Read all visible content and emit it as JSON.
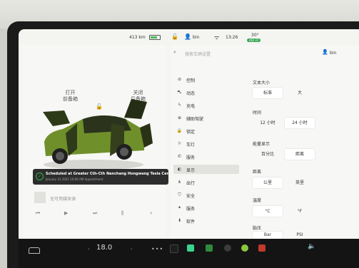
{
  "status": {
    "range": "413 km",
    "user": "bin",
    "time": "13:26",
    "outside_temp": "30°",
    "air_quality": "AQI 37"
  },
  "car_panel": {
    "front_trunk": {
      "action": "打开",
      "label": "前备箱"
    },
    "rear_trunk": {
      "action": "关闭",
      "label": "后备箱"
    },
    "notification": {
      "title": "Scheduled at Greater Cth-Cth Nanchang Hongwang Tesla Center",
      "subtitle": "January 31 2021 10:00 AM Appointment"
    },
    "media": {
      "source_label": "无可用媒体源",
      "controls": [
        "⏮",
        "▶",
        "⏭",
        "⫼",
        "⌕"
      ]
    }
  },
  "settings": {
    "search_placeholder": "搜索车辆设置",
    "user": "bin",
    "menu": [
      {
        "icon": "toggle-icon",
        "label": "控制",
        "active": false
      },
      {
        "icon": "car-icon",
        "label": "动态",
        "active": false
      },
      {
        "icon": "bolt-icon",
        "label": "充电",
        "active": false
      },
      {
        "icon": "steering-icon",
        "label": "辅助驾驶",
        "active": false
      },
      {
        "icon": "lock-icon",
        "label": "锁定",
        "active": false
      },
      {
        "icon": "light-icon",
        "label": "车灯",
        "active": false
      },
      {
        "icon": "phone-icon",
        "label": "服务",
        "active": false
      },
      {
        "icon": "display-icon",
        "label": "显示",
        "active": true
      },
      {
        "icon": "route-icon",
        "label": "出行",
        "active": false
      },
      {
        "icon": "shield-icon",
        "label": "安全",
        "active": false
      },
      {
        "icon": "wrench-icon",
        "label": "服务",
        "active": false
      },
      {
        "icon": "download-icon",
        "label": "软件",
        "active": false
      }
    ],
    "groups": [
      {
        "label": "文本大小",
        "options": [
          "标准",
          "大"
        ],
        "selected": 0
      },
      {
        "label": "时间",
        "options": [
          "12 小时",
          "24 小时"
        ],
        "selected": 1
      },
      {
        "label": "能量显示",
        "options": [
          "百分比",
          "距离"
        ],
        "selected": 1
      },
      {
        "label": "距离",
        "options": [
          "公里",
          "英里"
        ],
        "selected": 0
      },
      {
        "label": "温度",
        "options": [
          "°C",
          "°F"
        ],
        "selected": 0
      },
      {
        "label": "胎压",
        "options": [
          "Bar",
          "PSI"
        ],
        "selected": 0
      }
    ]
  },
  "dock": {
    "cabin_temp": "18.0",
    "apps": [
      {
        "icon": "camera-app-icon",
        "color": "#1e1e1e"
      },
      {
        "icon": "phone-app-icon",
        "color": "#3ad58e"
      },
      {
        "icon": "calendar-app-icon",
        "color": "#2f8a3c"
      },
      {
        "icon": "toybox-app-icon",
        "color": "#3b3b3b"
      },
      {
        "icon": "music-app-icon",
        "color": "#8cc63f"
      },
      {
        "icon": "energy-app-icon",
        "color": "#c0392b"
      }
    ]
  }
}
